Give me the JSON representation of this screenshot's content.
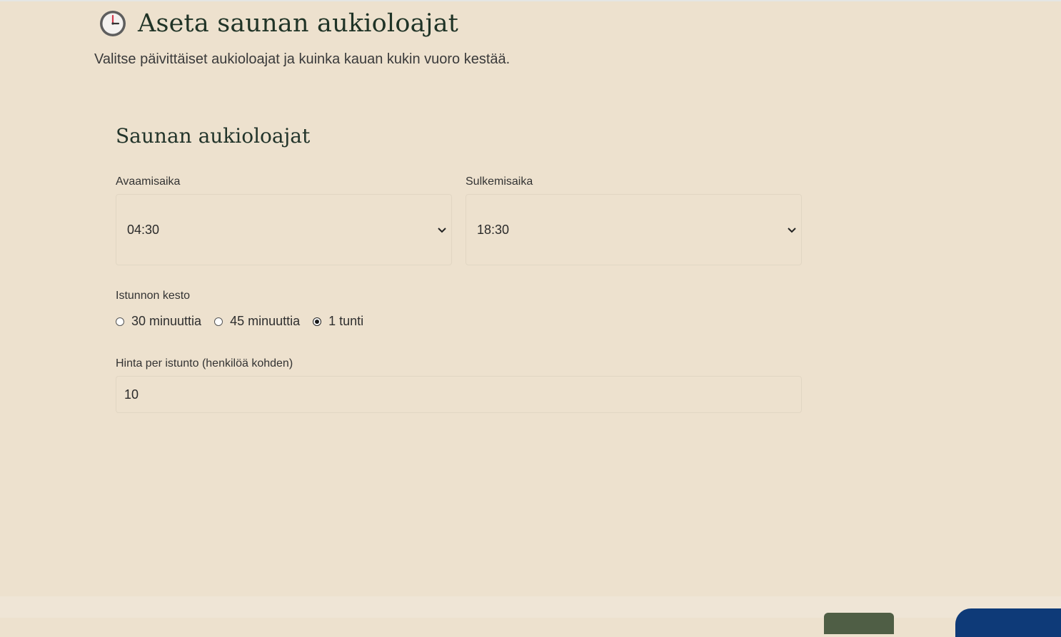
{
  "header": {
    "title": "Aseta saunan aukioloajat",
    "subtitle": "Valitse päivittäiset aukioloajat ja kuinka kauan kukin vuoro kestää.",
    "icon": "clock-icon"
  },
  "form": {
    "section_title": "Saunan aukioloajat",
    "opening": {
      "label": "Avaamisaika",
      "value": "04:30"
    },
    "closing": {
      "label": "Sulkemisaika",
      "value": "18:30"
    },
    "session_length": {
      "label": "Istunnon kesto",
      "options": [
        {
          "label": "30 minuuttia",
          "checked": false
        },
        {
          "label": "45 minuuttia",
          "checked": false
        },
        {
          "label": "1 tunti",
          "checked": true
        }
      ]
    },
    "price": {
      "label": "Hinta per istunto (henkilöä kohden)",
      "value": "10"
    }
  },
  "colors": {
    "background": "#ede1ce",
    "title": "#1f3326",
    "back_button": "#4f5e45",
    "next_button": "#0e3a78"
  }
}
